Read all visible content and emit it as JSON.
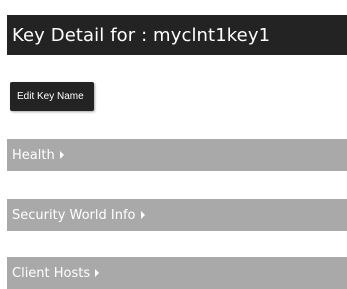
{
  "header": {
    "title": "Key Detail for : myclnt1key1"
  },
  "actions": {
    "edit_key_name_label": "Edit Key Name"
  },
  "sections": [
    {
      "label": "Health",
      "icon": "caret-right-icon"
    },
    {
      "label": "Security World Info",
      "icon": "caret-right-icon"
    },
    {
      "label": "Client Hosts",
      "icon": "caret-right-icon"
    }
  ],
  "colors": {
    "header_bg": "#232323",
    "section_bg": "#a9a9a9",
    "text_light": "#ffffff"
  }
}
